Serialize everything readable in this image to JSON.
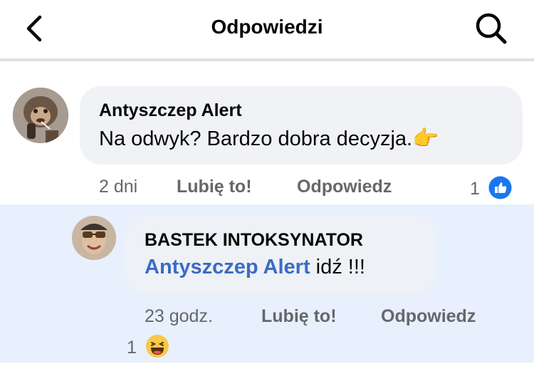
{
  "header": {
    "title": "Odpowiedzi",
    "back_icon": "chevron-left-icon",
    "search_icon": "search-icon"
  },
  "comment": {
    "author": "Antyszczep Alert",
    "text": "Na odwyk? Bardzo dobra decyzja.",
    "emoji": "👉",
    "time": "2 dni",
    "like_label": "Lubię to!",
    "reply_label": "Odpowiedz",
    "reaction_count": "1",
    "reaction_icon": "like-icon"
  },
  "reply": {
    "author": "BASTEK INTOKSYNATOR",
    "mention": "Antyszczep Alert",
    "text": " idź !!!",
    "time": "23 godz.",
    "like_label": "Lubię to!",
    "reply_label": "Odpowiedz",
    "reaction_count": "1",
    "reaction_icon": "haha-icon"
  },
  "colors": {
    "accent": "#1877f2",
    "mention": "#3a6bc6",
    "reply_highlight": "#e7f0fc",
    "bubble": "#f0f2f5",
    "meta_text": "#65676b"
  }
}
